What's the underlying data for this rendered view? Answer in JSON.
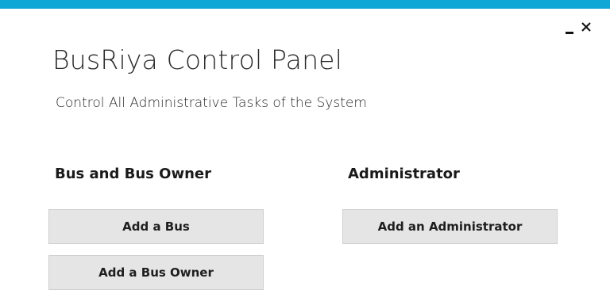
{
  "theme": {
    "accent": "#0fa7d6",
    "button_bg": "#e5e5e5"
  },
  "window_controls": {
    "minimize_icon": "minimize-icon",
    "close_icon": "close-icon",
    "close_glyph": "✕"
  },
  "header": {
    "title": "BusRiya Control Panel",
    "subtitle": "Control All Administrative Tasks of the System"
  },
  "sections": {
    "bus": {
      "heading": "Bus and Bus Owner",
      "add_bus_label": "Add a Bus",
      "add_owner_label": "Add a Bus Owner"
    },
    "admin": {
      "heading": "Administrator",
      "add_admin_label": "Add an Administrator"
    }
  }
}
